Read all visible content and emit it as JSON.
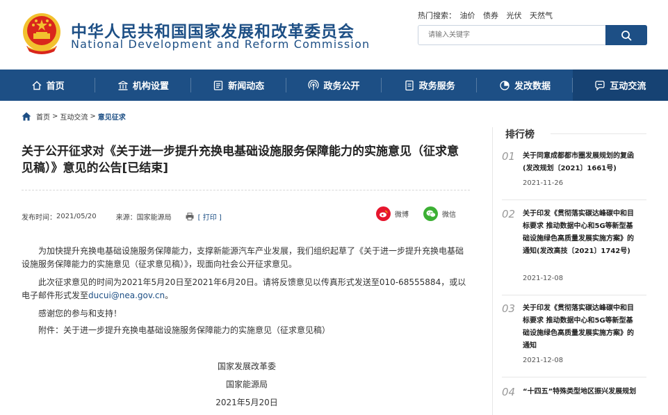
{
  "header": {
    "title_cn": "中华人民共和国国家发展和改革委员会",
    "title_en": "National Development and Reform Commission",
    "hot_label": "热门搜索：",
    "hot_items": [
      "油价",
      "债券",
      "光伏",
      "天然气"
    ],
    "search_placeholder": "请输入关键字"
  },
  "nav": {
    "items": [
      {
        "label": "首页",
        "icon": "home-icon"
      },
      {
        "label": "机构设置",
        "icon": "building-icon"
      },
      {
        "label": "新闻动态",
        "icon": "news-icon"
      },
      {
        "label": "政务公开",
        "icon": "broadcast-icon"
      },
      {
        "label": "政务服务",
        "icon": "document-icon"
      },
      {
        "label": "发改数据",
        "icon": "pie-chart-icon"
      },
      {
        "label": "互动交流",
        "icon": "chat-icon"
      }
    ],
    "active_index": 6
  },
  "breadcrumb": {
    "home": "首页",
    "sep": ">",
    "level1": "互动交流",
    "current": "意见征求"
  },
  "article": {
    "title": "关于公开征求对《关于进一步提升充换电基础设施服务保障能力的实施意见（征求意见稿）》意见的公告[已结束]",
    "publish_label": "发布时间：",
    "publish_date": "2021/05/20",
    "source_label": "来源：",
    "source": "国家能源局",
    "print_label": "[ 打印 ]",
    "share_weibo": "微博",
    "share_wechat": "微信",
    "para1": "为加快提升充换电基础设施服务保障能力，支撑新能源汽车产业发展，我们组织起草了《关于进一步提升充换电基础设施服务保障能力的实施意见（征求意见稿）》，现面向社会公开征求意见。",
    "para2_prefix": "此次征求意见的时间为2021年5月20日至2021年6月20日。请将反馈意见以传真形式发送至010-68555884，或以电子邮件形式发至",
    "para2_email": "ducui@nea.gov.cn",
    "para2_suffix": "。",
    "para3": "感谢您的参与和支持！",
    "para4": "附件：关于进一步提升充换电基础设施服务保障能力的实施意见（征求意见稿）",
    "sign1": "国家发展改革委",
    "sign2": "国家能源局",
    "sign3": "2021年5月20日"
  },
  "sidebar": {
    "title": "排行榜",
    "items": [
      {
        "no": "01",
        "text": "关于同意成都都市圈发展规划的复函(发改规划〔2021〕1661号)",
        "date": "2021-11-26"
      },
      {
        "no": "02",
        "text": "关于印发《贯彻落实碳达峰碳中和目标要求 推动数据中心和5G等新型基础设施绿色高质量发展实施方案》的通知(发改高技〔2021〕1742号)",
        "date": "2021-12-08"
      },
      {
        "no": "03",
        "text": "关于印发《贯彻落实碳达峰碳中和目标要求 推动数据中心和5G等新型基础设施绿色高质量发展实施方案》的通知",
        "date": "2021-12-08"
      },
      {
        "no": "04",
        "text": "“十四五”特殊类型地区振兴发展规划",
        "date": ""
      }
    ]
  },
  "colors": {
    "brand_blue": "#1d4f85",
    "nav_active": "#164273",
    "weibo_red": "#e6162d",
    "wechat_green": "#3cb034",
    "emblem_red": "#d9261c",
    "emblem_gold": "#f2c12e"
  }
}
